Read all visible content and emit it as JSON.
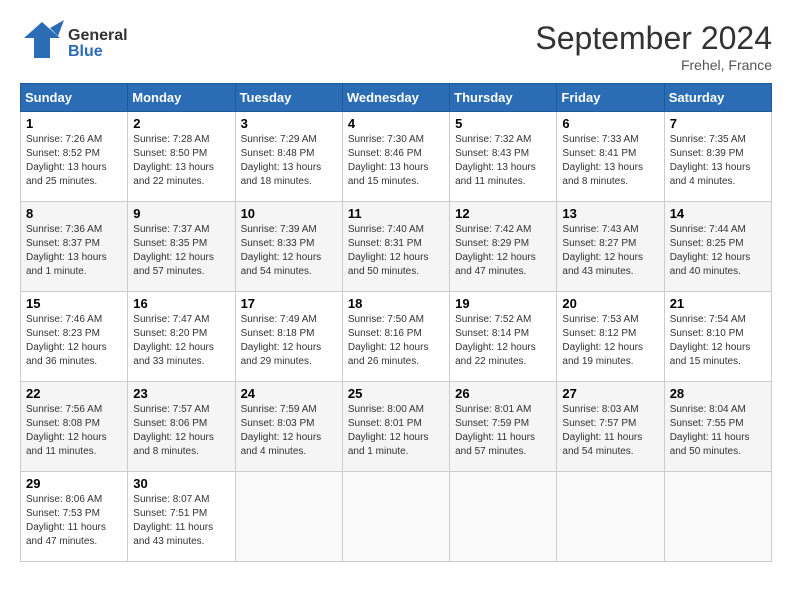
{
  "header": {
    "logo_general": "General",
    "logo_blue": "Blue",
    "title": "September 2024",
    "location": "Frehel, France"
  },
  "calendar": {
    "days_of_week": [
      "Sunday",
      "Monday",
      "Tuesday",
      "Wednesday",
      "Thursday",
      "Friday",
      "Saturday"
    ],
    "weeks": [
      [
        {
          "day": "",
          "info": ""
        },
        {
          "day": "2",
          "info": "Sunrise: 7:28 AM\nSunset: 8:50 PM\nDaylight: 13 hours\nand 22 minutes."
        },
        {
          "day": "3",
          "info": "Sunrise: 7:29 AM\nSunset: 8:48 PM\nDaylight: 13 hours\nand 18 minutes."
        },
        {
          "day": "4",
          "info": "Sunrise: 7:30 AM\nSunset: 8:46 PM\nDaylight: 13 hours\nand 15 minutes."
        },
        {
          "day": "5",
          "info": "Sunrise: 7:32 AM\nSunset: 8:43 PM\nDaylight: 13 hours\nand 11 minutes."
        },
        {
          "day": "6",
          "info": "Sunrise: 7:33 AM\nSunset: 8:41 PM\nDaylight: 13 hours\nand 8 minutes."
        },
        {
          "day": "7",
          "info": "Sunrise: 7:35 AM\nSunset: 8:39 PM\nDaylight: 13 hours\nand 4 minutes."
        }
      ],
      [
        {
          "day": "1",
          "info": "Sunrise: 7:26 AM\nSunset: 8:52 PM\nDaylight: 13 hours\nand 25 minutes."
        },
        {
          "day": "9",
          "info": "Sunrise: 7:37 AM\nSunset: 8:35 PM\nDaylight: 12 hours\nand 57 minutes."
        },
        {
          "day": "10",
          "info": "Sunrise: 7:39 AM\nSunset: 8:33 PM\nDaylight: 12 hours\nand 54 minutes."
        },
        {
          "day": "11",
          "info": "Sunrise: 7:40 AM\nSunset: 8:31 PM\nDaylight: 12 hours\nand 50 minutes."
        },
        {
          "day": "12",
          "info": "Sunrise: 7:42 AM\nSunset: 8:29 PM\nDaylight: 12 hours\nand 47 minutes."
        },
        {
          "day": "13",
          "info": "Sunrise: 7:43 AM\nSunset: 8:27 PM\nDaylight: 12 hours\nand 43 minutes."
        },
        {
          "day": "14",
          "info": "Sunrise: 7:44 AM\nSunset: 8:25 PM\nDaylight: 12 hours\nand 40 minutes."
        }
      ],
      [
        {
          "day": "8",
          "info": "Sunrise: 7:36 AM\nSunset: 8:37 PM\nDaylight: 13 hours\nand 1 minute."
        },
        {
          "day": "16",
          "info": "Sunrise: 7:47 AM\nSunset: 8:20 PM\nDaylight: 12 hours\nand 33 minutes."
        },
        {
          "day": "17",
          "info": "Sunrise: 7:49 AM\nSunset: 8:18 PM\nDaylight: 12 hours\nand 29 minutes."
        },
        {
          "day": "18",
          "info": "Sunrise: 7:50 AM\nSunset: 8:16 PM\nDaylight: 12 hours\nand 26 minutes."
        },
        {
          "day": "19",
          "info": "Sunrise: 7:52 AM\nSunset: 8:14 PM\nDaylight: 12 hours\nand 22 minutes."
        },
        {
          "day": "20",
          "info": "Sunrise: 7:53 AM\nSunset: 8:12 PM\nDaylight: 12 hours\nand 19 minutes."
        },
        {
          "day": "21",
          "info": "Sunrise: 7:54 AM\nSunset: 8:10 PM\nDaylight: 12 hours\nand 15 minutes."
        }
      ],
      [
        {
          "day": "15",
          "info": "Sunrise: 7:46 AM\nSunset: 8:23 PM\nDaylight: 12 hours\nand 36 minutes."
        },
        {
          "day": "23",
          "info": "Sunrise: 7:57 AM\nSunset: 8:06 PM\nDaylight: 12 hours\nand 8 minutes."
        },
        {
          "day": "24",
          "info": "Sunrise: 7:59 AM\nSunset: 8:03 PM\nDaylight: 12 hours\nand 4 minutes."
        },
        {
          "day": "25",
          "info": "Sunrise: 8:00 AM\nSunset: 8:01 PM\nDaylight: 12 hours\nand 1 minute."
        },
        {
          "day": "26",
          "info": "Sunrise: 8:01 AM\nSunset: 7:59 PM\nDaylight: 11 hours\nand 57 minutes."
        },
        {
          "day": "27",
          "info": "Sunrise: 8:03 AM\nSunset: 7:57 PM\nDaylight: 11 hours\nand 54 minutes."
        },
        {
          "day": "28",
          "info": "Sunrise: 8:04 AM\nSunset: 7:55 PM\nDaylight: 11 hours\nand 50 minutes."
        }
      ],
      [
        {
          "day": "22",
          "info": "Sunrise: 7:56 AM\nSunset: 8:08 PM\nDaylight: 12 hours\nand 11 minutes."
        },
        {
          "day": "30",
          "info": "Sunrise: 8:07 AM\nSunset: 7:51 PM\nDaylight: 11 hours\nand 43 minutes."
        },
        {
          "day": "",
          "info": ""
        },
        {
          "day": "",
          "info": ""
        },
        {
          "day": "",
          "info": ""
        },
        {
          "day": "",
          "info": ""
        },
        {
          "day": "",
          "info": ""
        }
      ],
      [
        {
          "day": "29",
          "info": "Sunrise: 8:06 AM\nSunset: 7:53 PM\nDaylight: 11 hours\nand 47 minutes."
        },
        {
          "day": "",
          "info": ""
        },
        {
          "day": "",
          "info": ""
        },
        {
          "day": "",
          "info": ""
        },
        {
          "day": "",
          "info": ""
        },
        {
          "day": "",
          "info": ""
        },
        {
          "day": "",
          "info": ""
        }
      ]
    ]
  }
}
